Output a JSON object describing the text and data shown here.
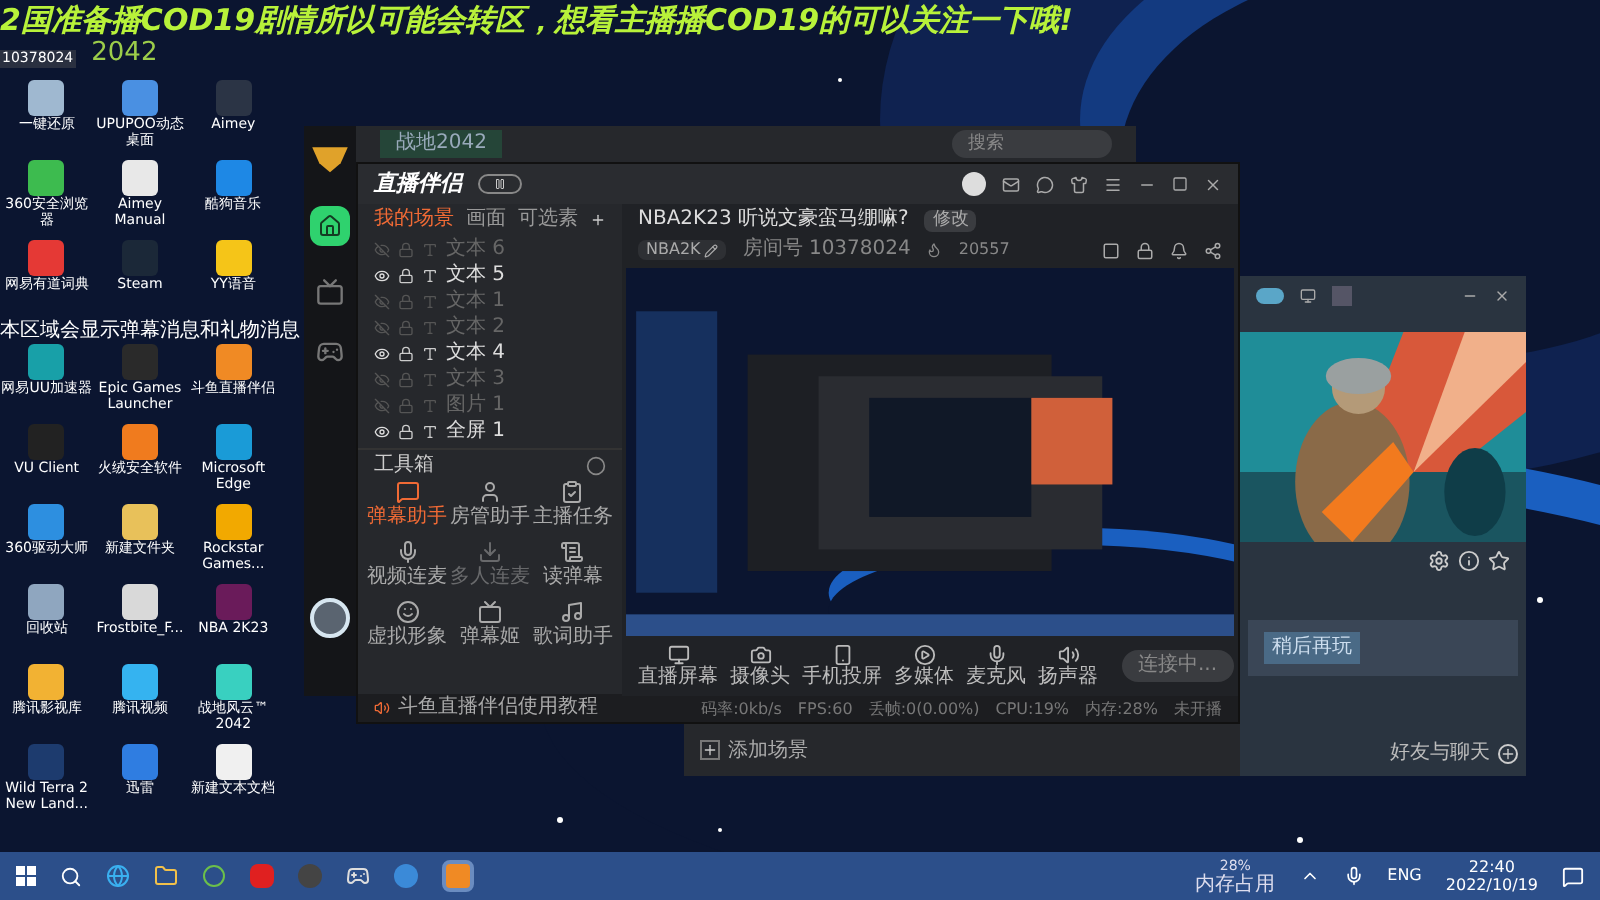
{
  "overlay": {
    "headline": "2国准备播COD19剧情所以可能会转区，想看主播播COD19的可以关注一下哦!",
    "subline": "2042",
    "room_id": "10378024"
  },
  "desktop_icons": [
    {
      "label": "一键还原",
      "color": "#9fb8d0"
    },
    {
      "label": "UPUPOO动态桌面",
      "color": "#4a90e2"
    },
    {
      "label": "Aimey",
      "color": "#2b3445"
    },
    {
      "label": "360安全浏览器",
      "color": "#3dbb4f"
    },
    {
      "label": "Aimey Manual",
      "color": "#e8e8e8"
    },
    {
      "label": "酷狗音乐",
      "color": "#1e88e5"
    },
    {
      "label": "网易有道词典",
      "color": "#e53935"
    },
    {
      "label": "Steam",
      "color": "#1b2838"
    },
    {
      "label": "YY语音",
      "color": "#f5c518"
    },
    {
      "label": "网易UU加速器",
      "color": "#18a0a8"
    },
    {
      "label": "Epic Games Launcher",
      "color": "#2a2a2a"
    },
    {
      "label": "斗鱼直播伴侣",
      "color": "#f08a24"
    },
    {
      "label": "VU Client",
      "color": "#222222"
    },
    {
      "label": "火绒安全软件",
      "color": "#f07b1e"
    },
    {
      "label": "Microsoft Edge",
      "color": "#1a9bd7"
    },
    {
      "label": "360驱动大师",
      "color": "#2d8fe0"
    },
    {
      "label": "新建文件夹",
      "color": "#e8c15a"
    },
    {
      "label": "Rockstar Games...",
      "color": "#f2a900"
    },
    {
      "label": "回收站",
      "color": "#8fa6bf"
    },
    {
      "label": "Frostbite_F...",
      "color": "#d9d9d9"
    },
    {
      "label": "NBA 2K23",
      "color": "#6a1b5a"
    },
    {
      "label": "腾讯影视库",
      "color": "#f2b233"
    },
    {
      "label": "腾讯视频",
      "color": "#35b3f0"
    },
    {
      "label": "战地风云™ 2042",
      "color": "#39d0c0"
    },
    {
      "label": "Wild Terra 2 New Land...",
      "color": "#1d3b6e"
    },
    {
      "label": "迅雷",
      "color": "#2f7de1"
    },
    {
      "label": "新建文本文档",
      "color": "#f0f0f0"
    }
  ],
  "danmaku": [
    "本区域会显示弹幕消息和礼物消息"
  ],
  "back_window": {
    "tab": "战地2042",
    "search_placeholder": "搜索"
  },
  "main_window": {
    "brand": "直播伴侣",
    "scene_tabs": [
      {
        "label": "我的场景",
        "selected": true
      },
      {
        "label": "画面",
        "selected": false
      },
      {
        "label": "可选素",
        "selected": false
      }
    ],
    "sources": [
      {
        "label": "文本 6",
        "visible": false
      },
      {
        "label": "文本 5",
        "visible": true
      },
      {
        "label": "文本 1",
        "visible": false
      },
      {
        "label": "文本 2",
        "visible": false
      },
      {
        "label": "文本 4",
        "visible": true
      },
      {
        "label": "文本 3",
        "visible": false
      },
      {
        "label": "图片 1",
        "visible": false
      },
      {
        "label": "全屏 1",
        "visible": true
      }
    ],
    "toolbox_title": "工具箱",
    "tools": [
      {
        "label": "弹幕助手",
        "selected": true,
        "disabled": false
      },
      {
        "label": "房管助手",
        "selected": false,
        "disabled": false
      },
      {
        "label": "主播任务",
        "selected": false,
        "disabled": false
      },
      {
        "label": "视频连麦",
        "selected": false,
        "disabled": false
      },
      {
        "label": "多人连麦",
        "selected": false,
        "disabled": true
      },
      {
        "label": "读弹幕",
        "selected": false,
        "disabled": false
      },
      {
        "label": "虚拟形象",
        "selected": false,
        "disabled": false
      },
      {
        "label": "弹幕姬",
        "selected": false,
        "disabled": false
      },
      {
        "label": "歌词助手",
        "selected": false,
        "disabled": false
      }
    ],
    "tutorial": "斗鱼直播伴侣使用教程",
    "stream_title": "NBA2K23 听说文豪蛮马绷嘛?",
    "edit_tag": "修改",
    "category": "NBA2K",
    "room": "房间号 10378024",
    "popularity": "20557",
    "controls": [
      {
        "label": "直播屏幕"
      },
      {
        "label": "摄像头"
      },
      {
        "label": "手机投屏"
      },
      {
        "label": "多媒体"
      },
      {
        "label": "麦克风"
      },
      {
        "label": "扬声器"
      }
    ],
    "connect_button": "连接中...",
    "stats": [
      "码率:0kb/s",
      "FPS:60",
      "丢帧:0(0.00%)",
      "CPU:19%",
      "内存:28%",
      "未开播"
    ]
  },
  "lower_window": {
    "add_scene": "添加场景"
  },
  "game_window": {
    "later_button": "稍后再玩",
    "friends": "好友与聊天"
  },
  "taskbar": {
    "memory_percent": "28%",
    "memory_label": "内存占用",
    "language": "ENG",
    "time": "22:40",
    "date": "2022/10/19"
  }
}
